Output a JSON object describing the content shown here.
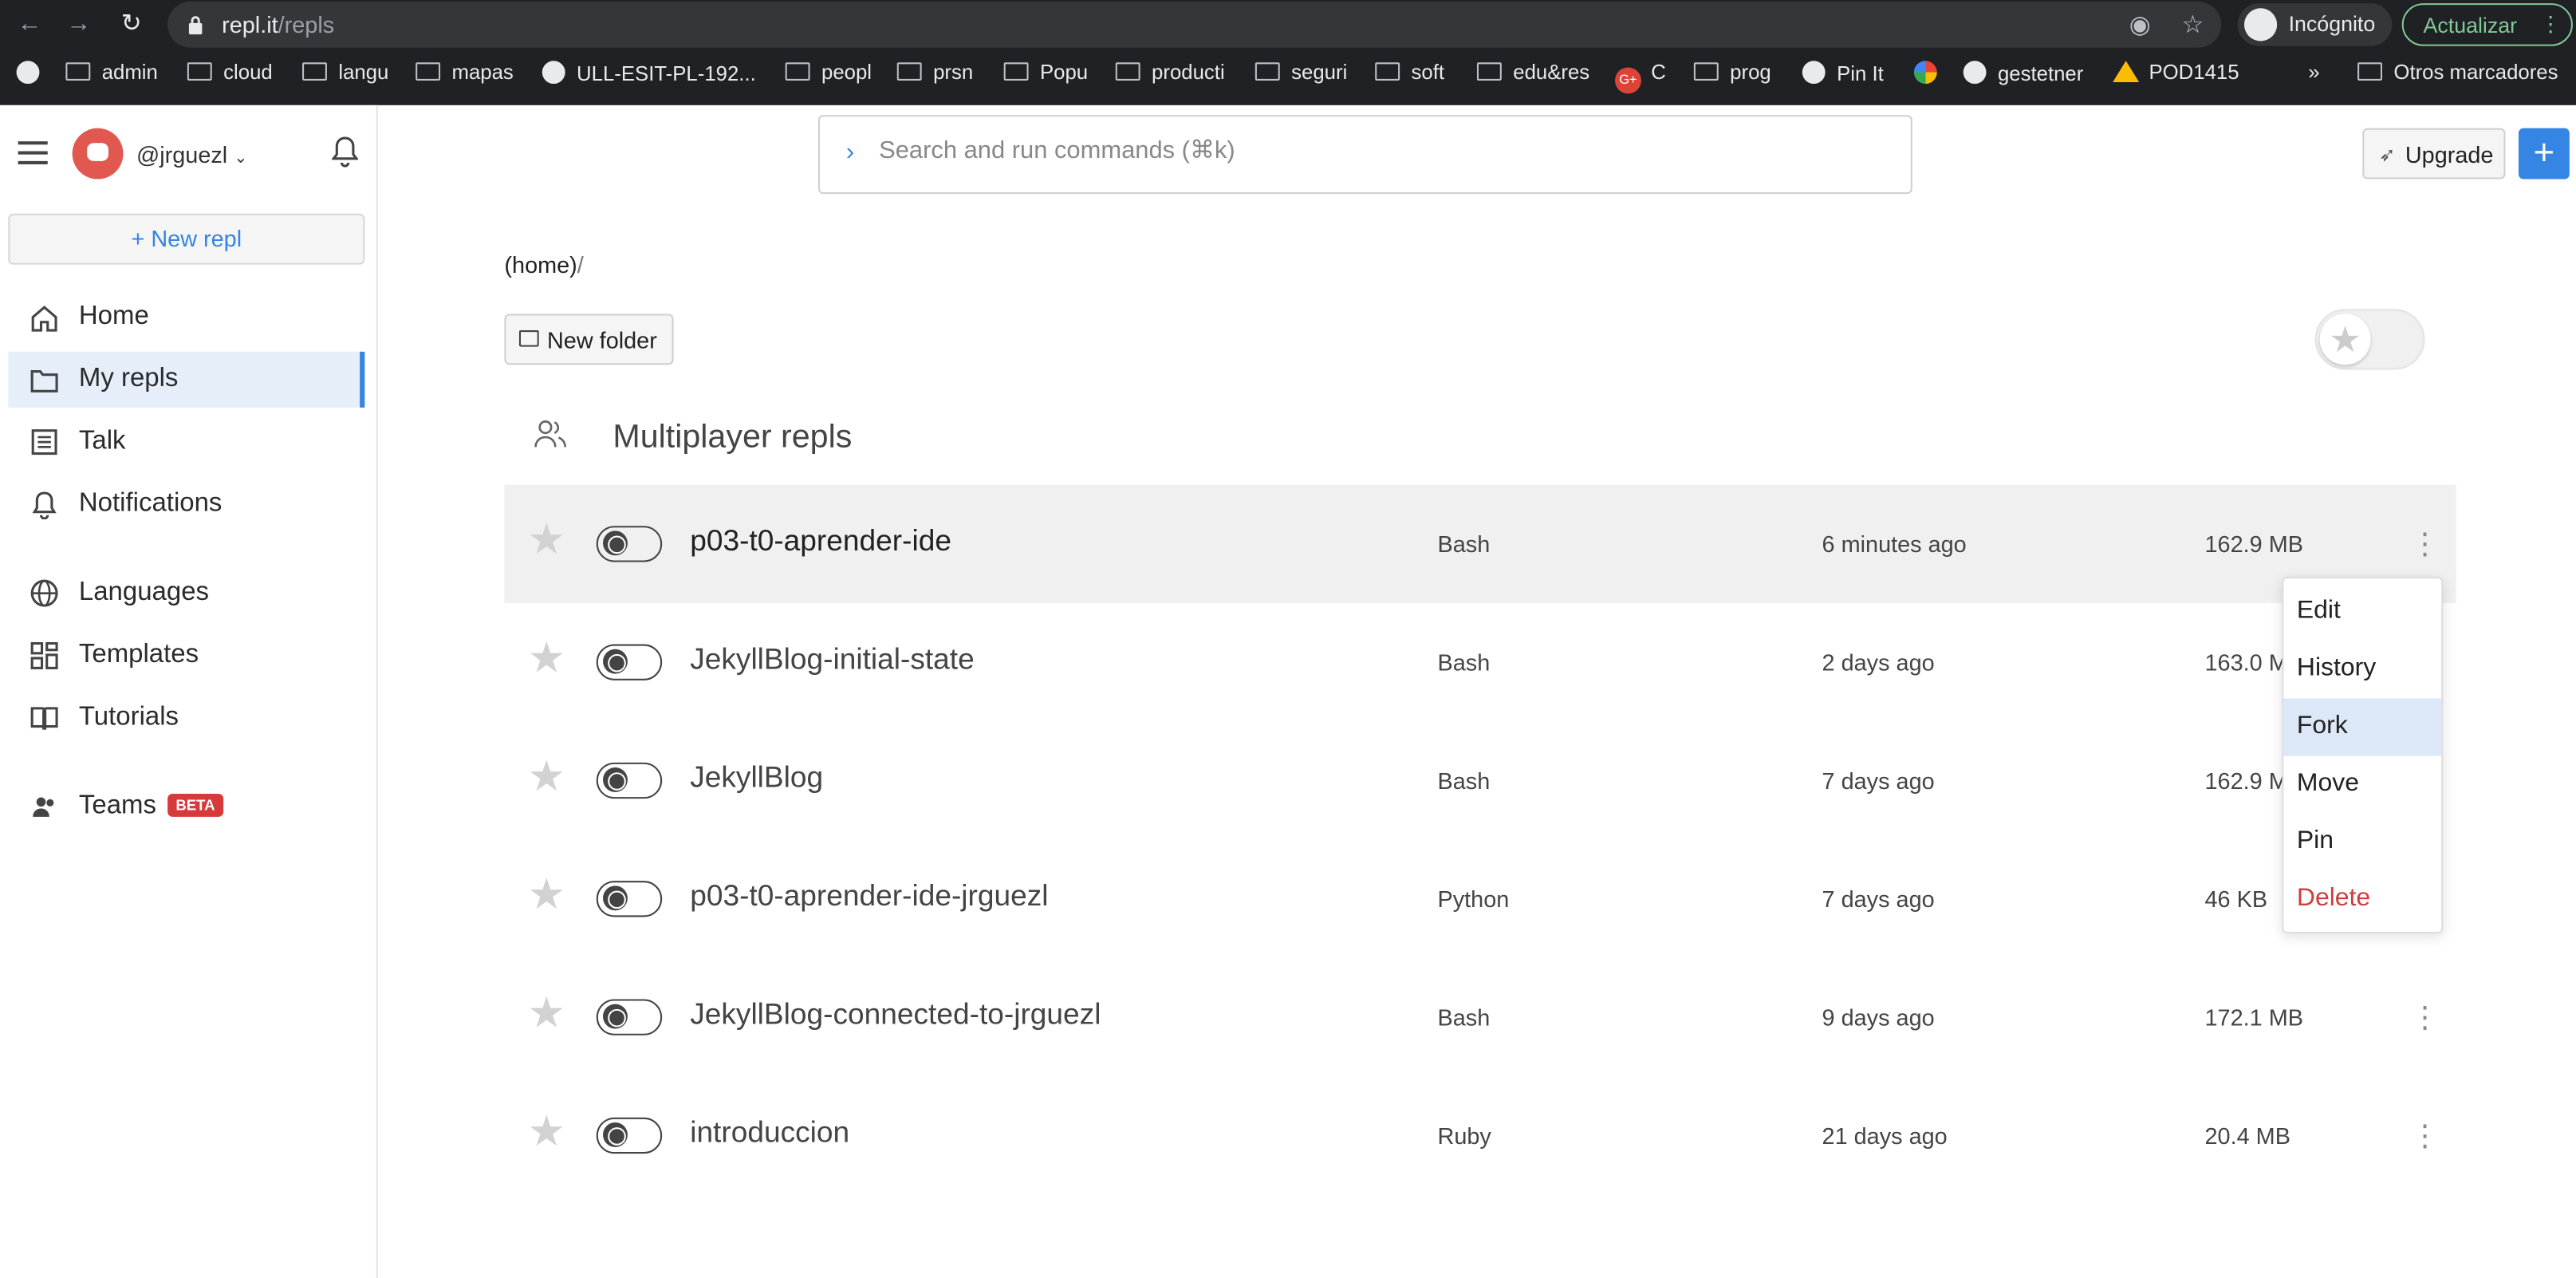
{
  "browser": {
    "url_host": "repl.it",
    "url_path": "/repls",
    "profile_label": "Incógnito",
    "update_label": "Actualizar",
    "bookmarks": [
      {
        "icon": "folder-icon",
        "label": "admin"
      },
      {
        "icon": "folder-icon",
        "label": "cloud"
      },
      {
        "icon": "folder-icon",
        "label": "langu"
      },
      {
        "icon": "folder-icon",
        "label": "mapas"
      },
      {
        "icon": "github-icon",
        "label": "ULL-ESIT-PL-192..."
      },
      {
        "icon": "folder-icon",
        "label": "peopl"
      },
      {
        "icon": "folder-icon",
        "label": "prsn"
      },
      {
        "icon": "folder-icon",
        "label": "Popu"
      },
      {
        "icon": "folder-icon",
        "label": "producti"
      },
      {
        "icon": "folder-icon",
        "label": "seguri"
      },
      {
        "icon": "folder-icon",
        "label": "soft"
      },
      {
        "icon": "folder-icon",
        "label": "edu&res"
      },
      {
        "icon": "google-plus-icon",
        "label": "C"
      },
      {
        "icon": "folder-icon",
        "label": "prog"
      },
      {
        "icon": "globe-icon",
        "label": "Pin It"
      },
      {
        "icon": "pinwheel-icon",
        "label": ""
      },
      {
        "icon": "globe-icon",
        "label": "gestetner"
      },
      {
        "icon": "drive-icon",
        "label": "POD1415"
      }
    ],
    "overflow_label": "»",
    "other_bookmarks_label": "Otros marcadores"
  },
  "user": {
    "handle": "@jrguezl"
  },
  "sidebar": {
    "new_repl_label": "+ New repl",
    "items": [
      {
        "label": "Home",
        "icon": "home-icon",
        "active": false
      },
      {
        "label": "My repls",
        "icon": "folder-icon",
        "active": true
      },
      {
        "label": "Talk",
        "icon": "talk-icon",
        "active": false
      },
      {
        "label": "Notifications",
        "icon": "bell-icon",
        "active": false
      },
      {
        "label": "Languages",
        "icon": "globe-icon",
        "active": false
      },
      {
        "label": "Templates",
        "icon": "templates-icon",
        "active": false
      },
      {
        "label": "Tutorials",
        "icon": "book-icon",
        "active": false
      },
      {
        "label": "Teams",
        "icon": "team-icon",
        "active": false,
        "badge": "BETA"
      }
    ]
  },
  "search": {
    "placeholder": "Search and run commands (⌘k)"
  },
  "header": {
    "upgrade_label": "Upgrade",
    "plus_label": "+"
  },
  "breadcrumb": {
    "home": "(home)",
    "sep": "/"
  },
  "folder": {
    "new_folder_label": "New folder"
  },
  "group": {
    "label": "Multiplayer repls"
  },
  "repls": [
    {
      "name": "p03-t0-aprender-ide",
      "lang": "Bash",
      "time": "6 minutes ago",
      "size": "162.9 MB"
    },
    {
      "name": "JekyllBlog-initial-state",
      "lang": "Bash",
      "time": "2 days ago",
      "size": "163.0 M"
    },
    {
      "name": "JekyllBlog",
      "lang": "Bash",
      "time": "7 days ago",
      "size": "162.9 M"
    },
    {
      "name": "p03-t0-aprender-ide-jrguezl",
      "lang": "Python",
      "time": "7 days ago",
      "size": "46 KB"
    },
    {
      "name": "JekyllBlog-connected-to-jrguezl",
      "lang": "Bash",
      "time": "9 days ago",
      "size": "172.1 MB"
    },
    {
      "name": "introduccion",
      "lang": "Ruby",
      "time": "21 days ago",
      "size": "20.4 MB"
    }
  ],
  "context_menu": {
    "items": [
      "Edit",
      "History",
      "Fork",
      "Move",
      "Pin",
      "Delete"
    ],
    "selected": "Fork"
  },
  "colors": {
    "accent": "#3485e4",
    "danger": "#d23c3c",
    "beta": "#d73a3a"
  }
}
